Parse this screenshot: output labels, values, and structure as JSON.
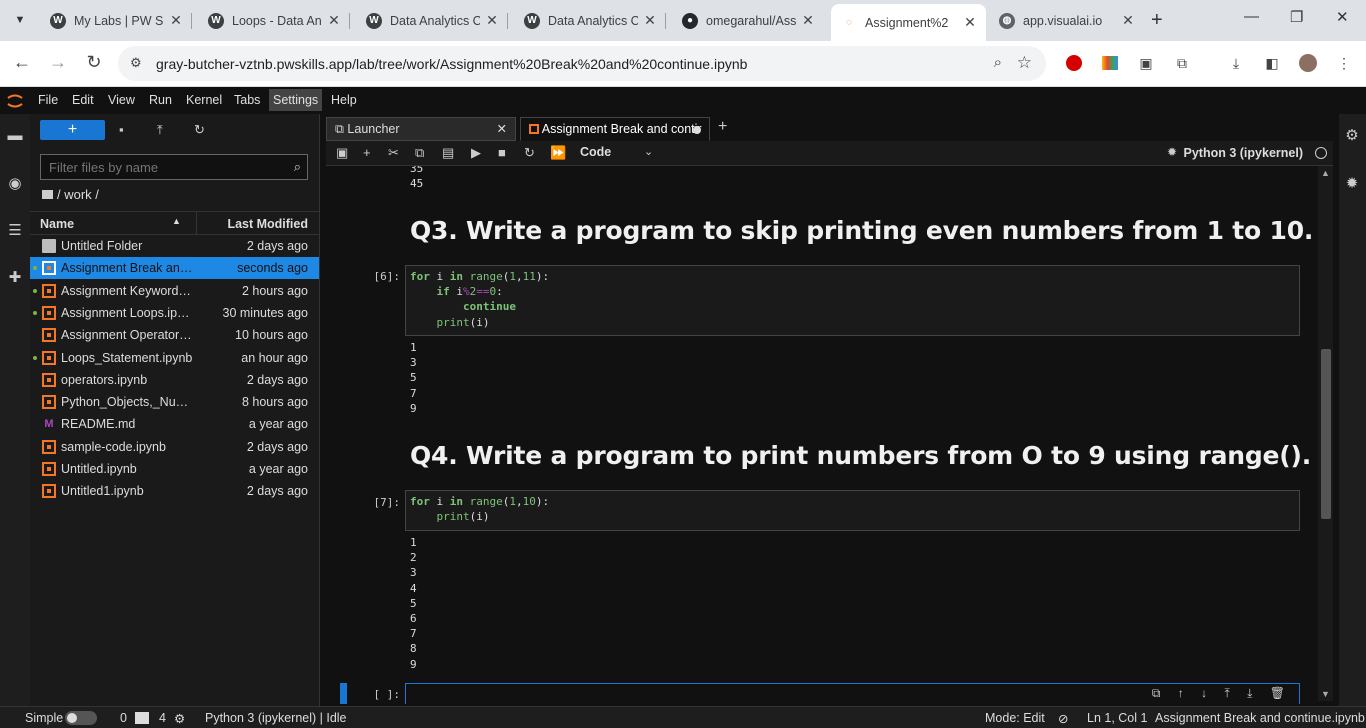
{
  "browser": {
    "tabs": [
      {
        "title": "My Labs | PW Sk",
        "icon": "wordpress-icon"
      },
      {
        "title": "Loops - Data An",
        "icon": "wordpress-icon"
      },
      {
        "title": "Data Analytics C",
        "icon": "wordpress-icon"
      },
      {
        "title": "Data Analytics C",
        "icon": "wordpress-icon"
      },
      {
        "title": "omegarahul/Ass",
        "icon": "github-icon"
      },
      {
        "title": "Assignment%2",
        "icon": "jupyter-icon"
      },
      {
        "title": "app.visualai.io",
        "icon": "globe-icon"
      }
    ],
    "url": "gray-butcher-vztnb.pwskills.app/lab/tree/work/Assignment%20Break%20and%20continue.ipynb"
  },
  "jupyter": {
    "menu": [
      "File",
      "Edit",
      "View",
      "Run",
      "Kernel",
      "Tabs",
      "Settings",
      "Help"
    ],
    "filebrowser": {
      "filter_placeholder": "Filter files by name",
      "breadcrumb": "/ work /",
      "col_name": "Name",
      "col_modified": "Last Modified",
      "files": [
        {
          "name": "Untitled Folder",
          "modified": "2 days ago",
          "type": "folder",
          "running": false
        },
        {
          "name": "Assignment Break and continue.ipynb",
          "modified": "seconds ago",
          "type": "notebook",
          "running": true
        },
        {
          "name": "Assignment Keywords.ipynb",
          "modified": "2 hours ago",
          "type": "notebook",
          "running": true
        },
        {
          "name": "Assignment Loops.ipynb",
          "modified": "30 minutes ago",
          "type": "notebook",
          "running": true
        },
        {
          "name": "Assignment Operators.ipynb",
          "modified": "10 hours ago",
          "type": "notebook",
          "running": false
        },
        {
          "name": "Loops_Statement.ipynb",
          "modified": "an hour ago",
          "type": "notebook",
          "running": true
        },
        {
          "name": "operators.ipynb",
          "modified": "2 days ago",
          "type": "notebook",
          "running": false
        },
        {
          "name": "Python_Objects,_Numbers.ipynb",
          "modified": "8 hours ago",
          "type": "notebook",
          "running": false
        },
        {
          "name": "README.md",
          "modified": "a year ago",
          "type": "markdown",
          "running": false
        },
        {
          "name": "sample-code.ipynb",
          "modified": "2 days ago",
          "type": "notebook",
          "running": false
        },
        {
          "name": "Untitled.ipynb",
          "modified": "a year ago",
          "type": "notebook",
          "running": false
        },
        {
          "name": "Untitled1.ipynb",
          "modified": "2 days ago",
          "type": "notebook",
          "running": false
        }
      ]
    },
    "dock_tabs": [
      {
        "label": "Launcher"
      },
      {
        "label": "Assignment Break and contir"
      }
    ],
    "notebook": {
      "cell_type": "Code",
      "kernel": "Python 3 (ipykernel)",
      "top_output": "35\n45",
      "q3_heading": "Q3. Write a program to skip printing even numbers from 1 to 10.",
      "cell6_prompt": "[6]:",
      "cell6_output": "1\n3\n5\n7\n9",
      "q4_heading": "Q4. Write a program to print numbers from O to 9 using range().",
      "cell7_prompt": "[7]:",
      "cell7_output": "1\n2\n3\n4\n5\n6\n7\n8\n9",
      "empty_prompt": "[ ]:"
    },
    "status": {
      "mode_label": "Simple",
      "terminals": "0",
      "kernels": "4",
      "kernel_status": "Python 3 (ipykernel) | Idle",
      "edit_mode": "Mode: Edit",
      "cursor": "Ln 1, Col 1",
      "filename": "Assignment Break and continue.ipynb"
    }
  },
  "colors": {
    "accent": "#1976d2",
    "notebook_icon": "#f37726",
    "running_dot": "#7cb342"
  }
}
